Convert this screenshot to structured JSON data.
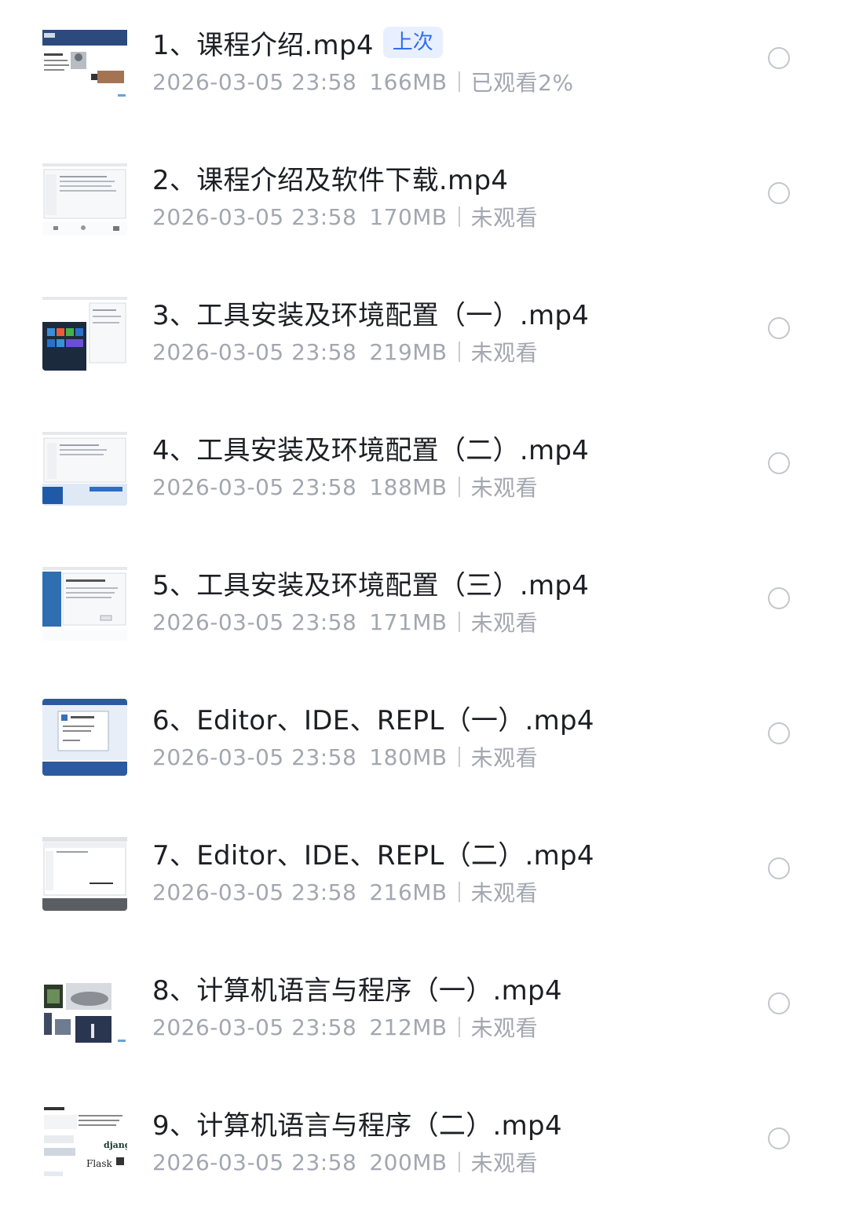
{
  "items": [
    {
      "title": "1、课程介绍.mp4",
      "badge": "上次",
      "date": "2026-03-05 23:58",
      "size": "166MB",
      "status": "已观看2%",
      "thumb": "slide-intro"
    },
    {
      "title": "2、课程介绍及软件下载.mp4",
      "badge": "",
      "date": "2026-03-05 23:58",
      "size": "170MB",
      "status": "未观看",
      "thumb": "screen-explorer"
    },
    {
      "title": "3、工具安装及环境配置（一）.mp4",
      "badge": "",
      "date": "2026-03-05 23:58",
      "size": "219MB",
      "status": "未观看",
      "thumb": "screen-windows-start"
    },
    {
      "title": "4、工具安装及环境配置（二）.mp4",
      "badge": "",
      "date": "2026-03-05 23:58",
      "size": "188MB",
      "status": "未观看",
      "thumb": "screen-installer"
    },
    {
      "title": "5、工具安装及环境配置（三）.mp4",
      "badge": "",
      "date": "2026-03-05 23:58",
      "size": "171MB",
      "status": "未观看",
      "thumb": "screen-setup-wizard"
    },
    {
      "title": "6、Editor、IDE、REPL（一）.mp4",
      "badge": "",
      "date": "2026-03-05 23:58",
      "size": "180MB",
      "status": "未观看",
      "thumb": "screen-python-window"
    },
    {
      "title": "7、Editor、IDE、REPL（二）.mp4",
      "badge": "",
      "date": "2026-03-05 23:58",
      "size": "216MB",
      "status": "未观看",
      "thumb": "screen-ide"
    },
    {
      "title": "8、计算机语言与程序（一）.mp4",
      "badge": "",
      "date": "2026-03-05 23:58",
      "size": "212MB",
      "status": "未观看",
      "thumb": "slide-photos"
    },
    {
      "title": "9、计算机语言与程序（二）.mp4",
      "badge": "",
      "date": "2026-03-05 23:58",
      "size": "200MB",
      "status": "未观看",
      "thumb": "slide-frameworks"
    }
  ],
  "thumb_text": {
    "django": "django",
    "flask": "Flask"
  },
  "colors": {
    "badge_text": "#2f6ef0",
    "badge_bg": "#e8efff",
    "meta_text": "#a3a7b0"
  }
}
